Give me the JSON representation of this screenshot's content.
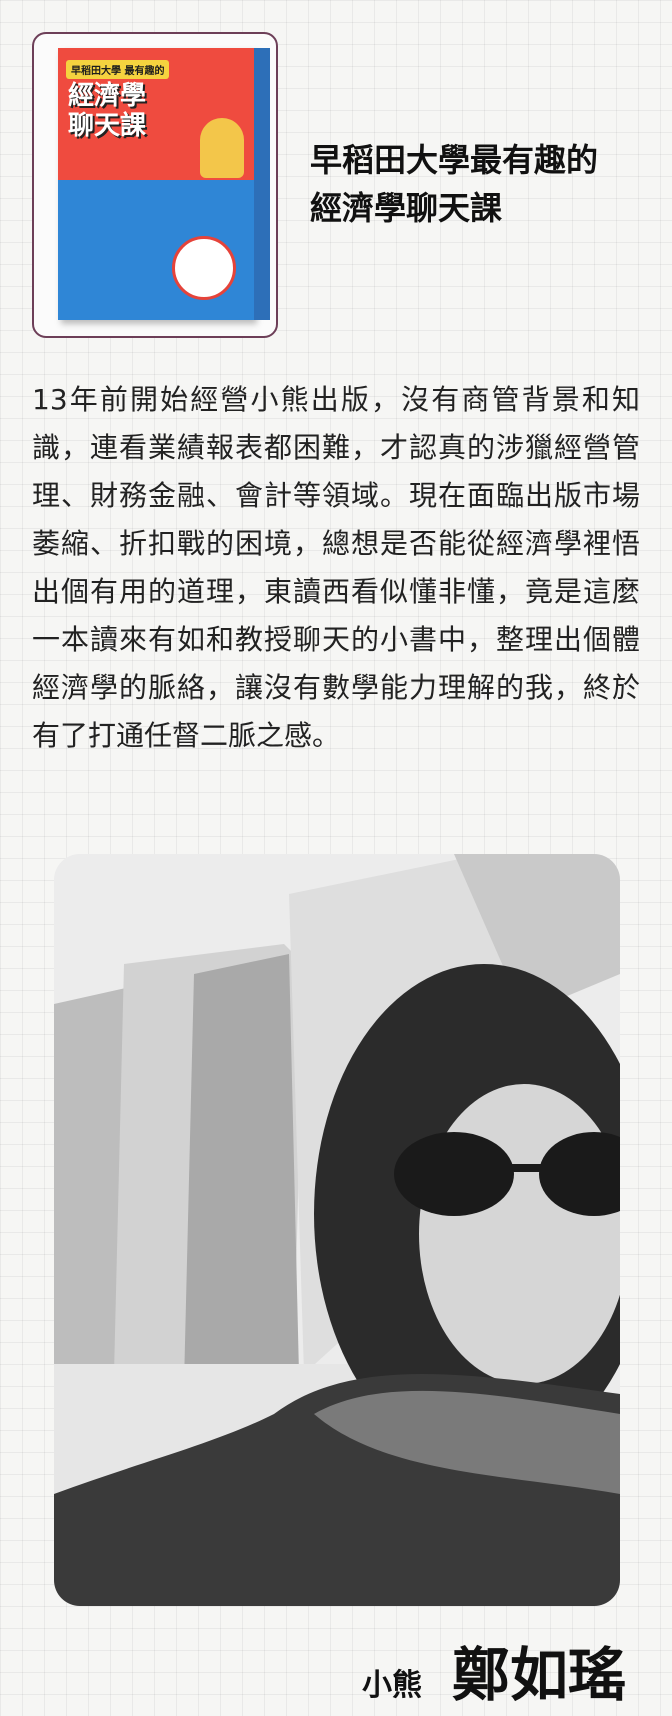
{
  "book": {
    "cover": {
      "tag": "早稻田大學 最有趣的",
      "title": "經濟學聊天課"
    },
    "title_line1": "早稻田大學最有趣的",
    "title_line2": "經濟學聊天課"
  },
  "review": {
    "text": "13年前開始經營小熊出版，沒有商管背景和知識，連看業績報表都困難，才認真的涉獵經營管理、財務金融、會計等領域。現在面臨出版市場萎縮、折扣戰的困境，總想是否能從經濟學裡悟出個有用的道理，東讀西看似懂非懂，竟是這麼一本讀來有如和教授聊天的小書中，整理出個體經濟學的脈絡，讓沒有數學能力理解的我，終於有了打通任督二脈之感。"
  },
  "byline": {
    "role": "小熊",
    "name": "鄭如瑤"
  },
  "colors": {
    "frame_border": "#6d3f58",
    "cover_red": "#e5433a",
    "cover_blue": "#2f86d6"
  }
}
